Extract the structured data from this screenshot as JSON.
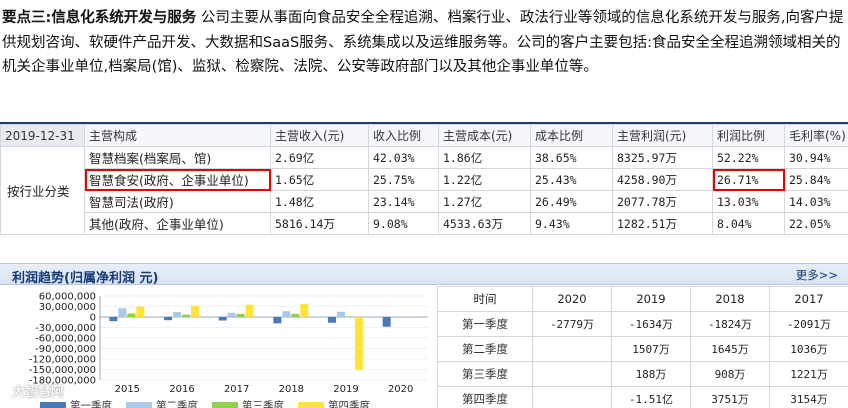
{
  "intro": {
    "lead": "要点三:",
    "lead_title": "信息化系统开发与服务",
    "body": " 公司主要从事面向食品安全全程追溯、档案行业、政法行业等领域的信息化系统开发与服务,向客户提供规划咨询、软硬件产品开发、大数据和SaaS服务、系统集成以及运维服务等。公司的客户主要包括:食品安全全程追溯领域相关的机关企事业单位,档案局(馆)、监狱、检察院、法院、公安等政府部门以及其他企事业单位等。"
  },
  "business_table": {
    "date": "2019-12-31",
    "headers": [
      "主营构成",
      "主营收入(元)",
      "收入比例",
      "主营成本(元)",
      "成本比例",
      "主营利润(元)",
      "利润比例",
      "毛利率(%)"
    ],
    "category": "按行业分类",
    "rows": [
      [
        "智慧档案(档案局、馆)",
        "2.69亿",
        "42.03%",
        "1.86亿",
        "38.65%",
        "8325.97万",
        "52.22%",
        "30.94%"
      ],
      [
        "智慧食安(政府、企事业单位)",
        "1.65亿",
        "25.75%",
        "1.22亿",
        "25.43%",
        "4258.90万",
        "26.71%",
        "25.84%"
      ],
      [
        "智慧司法(政府)",
        "1.48亿",
        "23.14%",
        "1.27亿",
        "26.49%",
        "2077.78万",
        "13.03%",
        "14.03%"
      ],
      [
        "其他(政府、企事业单位)",
        "5816.14万",
        "9.08%",
        "4533.63万",
        "9.43%",
        "1282.51万",
        "8.04%",
        "22.05%"
      ]
    ]
  },
  "panel": {
    "title": "利润趋势(归属净利润 元)",
    "more": "更多>>"
  },
  "chart_data": {
    "type": "bar",
    "title": "利润趋势(归属净利润 元)",
    "categories": [
      "2015",
      "2016",
      "2017",
      "2018",
      "2019",
      "2020"
    ],
    "y_ticks": [
      "60,000,000",
      "30,000,000",
      "0",
      "-30,000,000",
      "-60,000,000",
      "-90,000,000",
      "-120,000,000",
      "-150,000,000",
      "-180,000,000"
    ],
    "ylim": [
      -180000000,
      60000000
    ],
    "series": [
      {
        "name": "第一季度",
        "color": "#4a79b8",
        "values": [
          -12000000,
          -9000000,
          -10000000,
          -18240000,
          -16340000,
          -27790000
        ]
      },
      {
        "name": "第二季度",
        "color": "#a9c8ea",
        "values": [
          25000000,
          14000000,
          12000000,
          16450000,
          15070000,
          null
        ]
      },
      {
        "name": "第三季度",
        "color": "#8ed14b",
        "values": [
          10000000,
          7000000,
          9000000,
          9080000,
          1880000,
          null
        ]
      },
      {
        "name": "第四季度",
        "color": "#ffe23a",
        "values": [
          30000000,
          32000000,
          35000000,
          37510000,
          -151000000,
          null
        ]
      }
    ]
  },
  "trend_table": {
    "headers": [
      "时间",
      "2020",
      "2019",
      "2018",
      "2017"
    ],
    "rows": [
      [
        "第一季度",
        "-2779万",
        "-1634万",
        "-1824万",
        "-2091万"
      ],
      [
        "第二季度",
        "",
        "1507万",
        "1645万",
        "1036万"
      ],
      [
        "第三季度",
        "",
        "188万",
        "908万",
        "1221万"
      ],
      [
        "第四季度",
        "",
        "-1.51亿",
        "3751万",
        "3154万"
      ]
    ]
  },
  "watermark": "大智慧阿"
}
